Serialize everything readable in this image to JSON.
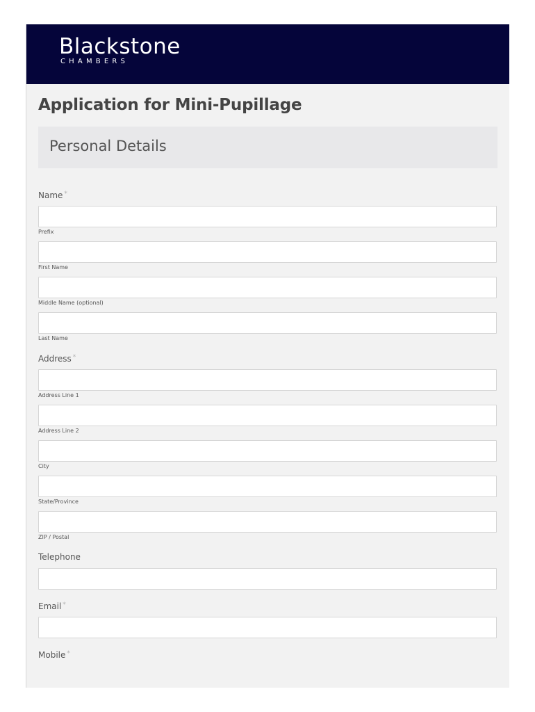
{
  "brand": {
    "name": "Blackstone",
    "subtitle": "CHAMBERS",
    "header_color": "#05053a"
  },
  "form": {
    "title": "Application for Mini-Pupillage",
    "section_title": "Personal Details",
    "required_marker": "*",
    "name": {
      "label": "Name",
      "fields": [
        {
          "sublabel": "Prefix",
          "value": ""
        },
        {
          "sublabel": "First Name",
          "value": ""
        },
        {
          "sublabel": "Middle Name (optional)",
          "value": ""
        },
        {
          "sublabel": "Last Name",
          "value": ""
        }
      ]
    },
    "address": {
      "label": "Address",
      "fields": [
        {
          "sublabel": "Address Line 1",
          "value": ""
        },
        {
          "sublabel": "Address Line 2",
          "value": ""
        },
        {
          "sublabel": "City",
          "value": ""
        },
        {
          "sublabel": "State/Province",
          "value": ""
        },
        {
          "sublabel": "ZIP / Postal",
          "value": ""
        }
      ]
    },
    "telephone": {
      "label": "Telephone",
      "value": ""
    },
    "email": {
      "label": "Email",
      "value": ""
    },
    "mobile": {
      "label": "Mobile"
    }
  }
}
